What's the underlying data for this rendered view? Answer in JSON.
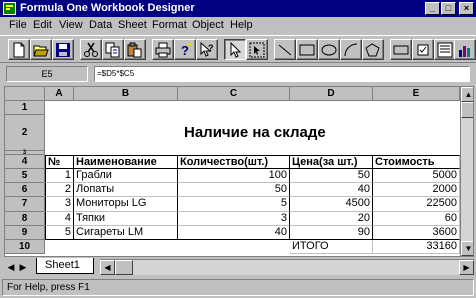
{
  "window": {
    "title": "Formula One Workbook Designer",
    "minimize_glyph": "_",
    "maximize_glyph": "□",
    "close_glyph": "×"
  },
  "menu": [
    "File",
    "Edit",
    "View",
    "Data",
    "Sheet",
    "Format",
    "Object",
    "Help"
  ],
  "toolbar": {
    "icons": [
      "new-file-icon",
      "open-folder-icon",
      "save-icon",
      "cut-icon",
      "copy-icon",
      "paste-icon",
      "print-icon",
      "help-icon",
      "context-help-icon",
      "select-pointer-icon",
      "select-object-icon",
      "line-icon",
      "rectangle-icon",
      "ellipse-icon",
      "arc-icon",
      "polygon-icon",
      "button-icon",
      "checkbox-icon",
      "dropdown-icon",
      "chart-icon"
    ]
  },
  "formula_bar": {
    "cell_ref": "E5",
    "formula": "=$D5*$C5"
  },
  "grid": {
    "columns": [
      "A",
      "B",
      "C",
      "D",
      "E"
    ],
    "rows": [
      "1",
      "2",
      "3",
      "4",
      "5",
      "6",
      "7",
      "8",
      "9",
      "10"
    ],
    "title": "Наличие на складе",
    "headers": [
      "№",
      "Наименование",
      "Количество(шт.)",
      "Цена(за шт.)",
      "Стоимость"
    ],
    "items": [
      {
        "n": "1",
        "name": "Грабли",
        "qty": "100",
        "price": "50",
        "cost": "5000"
      },
      {
        "n": "2",
        "name": "Лопаты",
        "qty": "50",
        "price": "40",
        "cost": "2000"
      },
      {
        "n": "3",
        "name": "Мониторы LG",
        "qty": "5",
        "price": "4500",
        "cost": "22500"
      },
      {
        "n": "4",
        "name": "Тяпки",
        "qty": "3",
        "price": "20",
        "cost": "60"
      },
      {
        "n": "5",
        "name": "Сигареты LM",
        "qty": "40",
        "price": "90",
        "cost": "3600"
      }
    ],
    "total_label": "ИТОГО",
    "total_value": "33160"
  },
  "tabs": {
    "sheet": "Sheet1"
  },
  "status": {
    "text": "For Help, press F1"
  }
}
